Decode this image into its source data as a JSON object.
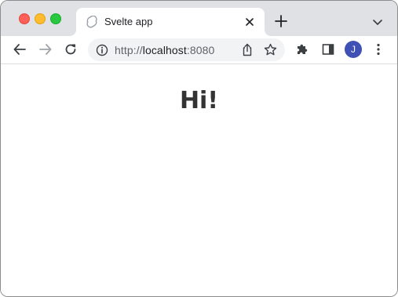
{
  "browser": {
    "tab": {
      "title": "Svelte app",
      "favicon": "svelte-icon"
    },
    "address_bar": {
      "scheme": "http://",
      "host": "localhost",
      "port": ":8080"
    },
    "profile_initial": "J",
    "icons": [
      "back-icon",
      "forward-icon",
      "reload-icon",
      "info-icon",
      "share-icon",
      "star-icon",
      "extensions-icon",
      "side-panel-icon",
      "menu-icon",
      "close-icon",
      "plus-icon",
      "chevron-down-icon"
    ],
    "colors": {
      "tab_strip": "#dfe1e5",
      "omnibox": "#f1f3f4",
      "avatar": "#3f51b5"
    }
  },
  "page": {
    "heading": "Hi!"
  }
}
